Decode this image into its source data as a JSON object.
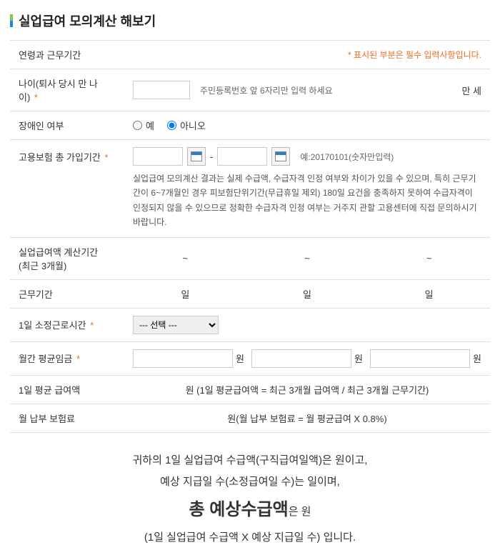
{
  "title": "실업급여 모의계산 해보기",
  "required_note_star": "*",
  "required_note_text": " 표시된 부분은 필수 입력사항입니다.",
  "rows": {
    "age_period": "연령과 근무기간",
    "age": "나이(퇴사 당시 만 나이)",
    "age_hint": "주민등록번호 앞 6자리만 입력 하세요",
    "age_unit": "만 세",
    "disabled": "장애인 여부",
    "yes": "예",
    "no": "아니오",
    "insured_period": "고용보험 총 가입기간",
    "date_sep": "-",
    "date_example": "예:20170101(숫자만입력)",
    "insured_desc": "실업급여 모의계산 결과는 실제 수급액, 수급자격 인정 여부와 차이가 있을 수 있으며, 특히 근무기간이 6~7개월인 경우 피보험단위기간(무급휴일 제외) 180일 요건을 충족하지 못하여 수급자격이 인정되지 않을 수 있으므로 정확한 수급자격 인정 여부는 거주지 관할 고용센터에 직접 문의하시기 바랍니다.",
    "calc_period": "실업급여액 계산기간\n(최근 3개월)",
    "tilde": "~",
    "work_period": "근무기간",
    "day_unit": "일",
    "prescribed_hours": "1일 소정근로시간",
    "select_placeholder": "--- 선택 ---",
    "monthly_wage": "월간 평균임금",
    "won": "원",
    "daily_wage": "1일 평균 급여액",
    "daily_wage_formula": "원 (1일 평균급여액 = 최근 3개월 급여액 / 최근 3개월 근무기간)",
    "monthly_premium": "월 납부 보험료",
    "monthly_premium_formula": "원(월 납부 보험료 = 월 평균급여 X 0.8%)"
  },
  "result": {
    "line1a": "귀하의 1일 실업급여 수급액(구직급여일액)은 ",
    "line1b": "원이고,",
    "line2a": "예상 지급일 수(소정급여일 수)는 ",
    "line2b": "일이며,",
    "big_label": "총 예상수급액",
    "big_suffix": "은 원",
    "line4": "(1일 실업급여 수급액 X 예상 지급일 수) 입니다."
  }
}
